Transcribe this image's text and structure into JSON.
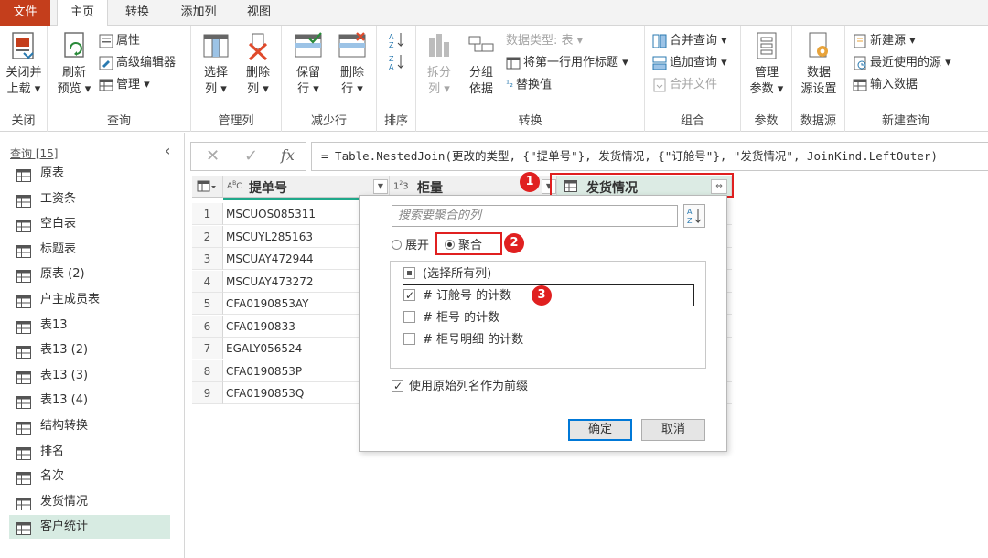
{
  "tabs": [
    "文件",
    "主页",
    "转换",
    "添加列",
    "视图"
  ],
  "ribbon": {
    "close": {
      "btn": "关闭并\n上载",
      "btn1": "关闭并",
      "btn2": "上载 ▾",
      "label": "关闭"
    },
    "query": {
      "refresh1": "刷新",
      "refresh2": "预览 ▾",
      "properties": "属性",
      "advanced_editor": "高级编辑器",
      "manage": "管理 ▾",
      "label": "查询"
    },
    "manage_cols": {
      "select1": "选择",
      "select2": "列 ▾",
      "delete1": "删除",
      "delete2": "列 ▾",
      "label": "管理列"
    },
    "reduce_rows": {
      "keep1": "保留",
      "keep2": "行 ▾",
      "remove1": "删除",
      "remove2": "行 ▾",
      "label": "减少行"
    },
    "sort": {
      "label": "排序"
    },
    "transform": {
      "split1": "拆分",
      "split2": "列 ▾",
      "group1": "分组",
      "group2": "依据",
      "datatype": "数据类型: 表 ▾",
      "first_row_header": "将第一行用作标题 ▾",
      "replace_values": "替换值",
      "label": "转换"
    },
    "combine": {
      "merge": "合并查询 ▾",
      "append": "追加查询 ▾",
      "combine_files": "合并文件",
      "label": "组合"
    },
    "params": {
      "manage1": "管理",
      "manage2": "参数 ▾",
      "label": "参数"
    },
    "datasource": {
      "settings1": "数据",
      "settings2": "源设置",
      "label": "数据源"
    },
    "new_query": {
      "new_source": "新建源 ▾",
      "recent": "最近使用的源 ▾",
      "enter_data": "输入数据",
      "label": "新建查询"
    }
  },
  "queries": {
    "header": "查询 [15]",
    "items": [
      "原表",
      "工资条",
      "空白表",
      "标题表",
      "原表 (2)",
      "户主成员表",
      "表13",
      "表13 (2)",
      "表13 (3)",
      "表13 (4)",
      "结构转换",
      "排名",
      "名次",
      "发货情况",
      "客户统计"
    ],
    "selected": "客户统计"
  },
  "formula": "= Table.NestedJoin(更改的类型, {\"提单号\"}, 发货情况, {\"订舱号\"}, \"发货情况\", JoinKind.LeftOuter)",
  "grid": {
    "columns": [
      {
        "type": "ABC",
        "name": "提单号"
      },
      {
        "type": "123",
        "name": "柜量"
      },
      {
        "type": "table",
        "name": "发货情况"
      }
    ],
    "rows": [
      {
        "n": "1",
        "bill": "MSCUOS085311"
      },
      {
        "n": "2",
        "bill": "MSCUYL285163"
      },
      {
        "n": "3",
        "bill": "MSCUAY472944"
      },
      {
        "n": "4",
        "bill": "MSCUAY473272"
      },
      {
        "n": "5",
        "bill": "CFA0190853AY"
      },
      {
        "n": "6",
        "bill": "CFA0190833"
      },
      {
        "n": "7",
        "bill": "EGALY056524"
      },
      {
        "n": "8",
        "bill": "CFA0190853P"
      },
      {
        "n": "9",
        "bill": "CFA0190853Q"
      }
    ]
  },
  "popup": {
    "search_placeholder": "搜索要聚合的列",
    "expand": "展开",
    "aggregate": "聚合",
    "select_all": "(选择所有列)",
    "columns": [
      "# 订舱号 的计数",
      "# 柜号 的计数",
      "# 柜号明细 的计数"
    ],
    "checked": [
      true,
      false,
      false
    ],
    "use_prefix": "使用原始列名作为前缀",
    "ok": "确定",
    "cancel": "取消"
  },
  "badges": [
    "1",
    "2",
    "3"
  ],
  "colors": {
    "file_tab": "#c43e1c",
    "selected_query": "#d7ebe2",
    "annotation": "#e02020",
    "accent_column": "#1fa88a"
  }
}
